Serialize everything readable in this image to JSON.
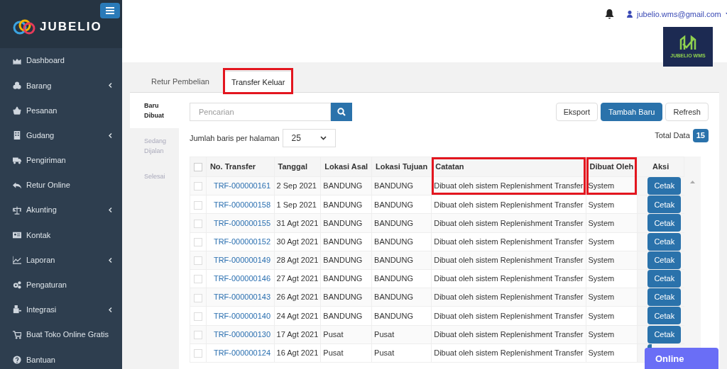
{
  "sidebar": {
    "brand": "JUBELIO",
    "items": [
      {
        "label": "Dashboard",
        "expandable": false
      },
      {
        "label": "Barang",
        "expandable": true
      },
      {
        "label": "Pesanan",
        "expandable": false
      },
      {
        "label": "Gudang",
        "expandable": true
      },
      {
        "label": "Pengiriman",
        "expandable": false
      },
      {
        "label": "Retur Online",
        "expandable": false
      },
      {
        "label": "Akunting",
        "expandable": true
      },
      {
        "label": "Kontak",
        "expandable": false
      },
      {
        "label": "Laporan",
        "expandable": true
      },
      {
        "label": "Pengaturan",
        "expandable": false
      },
      {
        "label": "Integrasi",
        "expandable": true
      },
      {
        "label": "Buat Toko Online Gratis",
        "expandable": false
      },
      {
        "label": "Bantuan",
        "expandable": false
      }
    ]
  },
  "header": {
    "user_email": "jubelio.wms@gmail.com",
    "badge_logo_text": "JUBELIO WMS"
  },
  "tabs": [
    {
      "label": "Retur Pembelian",
      "selected": false,
      "highlighted": false
    },
    {
      "label": "Transfer Keluar",
      "selected": true,
      "highlighted": true
    }
  ],
  "status_nav": [
    {
      "label": "Baru Dibuat",
      "selected": true
    },
    {
      "label": "Sedang Dijalan",
      "selected": false
    },
    {
      "label": "Selesai",
      "selected": false
    }
  ],
  "search": {
    "placeholder": "Pencarian"
  },
  "buttons": [
    {
      "label": "Eksport",
      "kind": "default"
    },
    {
      "label": "Tambah Baru",
      "kind": "primary"
    },
    {
      "label": "Refresh",
      "kind": "default"
    }
  ],
  "page_size": {
    "label": "Jumlah baris per halaman",
    "value": "25"
  },
  "total": {
    "label": "Total Data",
    "value": "15"
  },
  "table": {
    "all_checked": false,
    "columns": [
      {
        "label": "No. Transfer",
        "highlighted": false
      },
      {
        "label": "Tanggal",
        "highlighted": false
      },
      {
        "label": "Lokasi Asal",
        "highlighted": false
      },
      {
        "label": "Lokasi Tujuan",
        "highlighted": false
      },
      {
        "label": "Catatan",
        "highlighted": true
      },
      {
        "label": "Dibuat Oleh",
        "highlighted": true
      },
      {
        "label": "Aksi",
        "highlighted": false
      }
    ],
    "rows": [
      {
        "checked": false,
        "cells": [
          "TRF-000000161",
          "2 Sep 2021",
          "BANDUNG",
          "BANDUNG",
          "Dibuat oleh sistem Replenishment Transfer",
          "System"
        ],
        "action": "Cetak"
      },
      {
        "checked": false,
        "cells": [
          "TRF-000000158",
          "1 Sep 2021",
          "BANDUNG",
          "BANDUNG",
          "Dibuat oleh sistem Replenishment Transfer",
          "System"
        ],
        "action": "Cetak"
      },
      {
        "checked": false,
        "cells": [
          "TRF-000000155",
          "31 Agt 2021",
          "BANDUNG",
          "BANDUNG",
          "Dibuat oleh sistem Replenishment Transfer",
          "System"
        ],
        "action": "Cetak"
      },
      {
        "checked": false,
        "cells": [
          "TRF-000000152",
          "30 Agt 2021",
          "BANDUNG",
          "BANDUNG",
          "Dibuat oleh sistem Replenishment Transfer",
          "System"
        ],
        "action": "Cetak"
      },
      {
        "checked": false,
        "cells": [
          "TRF-000000149",
          "28 Agt 2021",
          "BANDUNG",
          "BANDUNG",
          "Dibuat oleh sistem Replenishment Transfer",
          "System"
        ],
        "action": "Cetak"
      },
      {
        "checked": false,
        "cells": [
          "TRF-000000146",
          "27 Agt 2021",
          "BANDUNG",
          "BANDUNG",
          "Dibuat oleh sistem Replenishment Transfer",
          "System"
        ],
        "action": "Cetak"
      },
      {
        "checked": false,
        "cells": [
          "TRF-000000143",
          "26 Agt 2021",
          "BANDUNG",
          "BANDUNG",
          "Dibuat oleh sistem Replenishment Transfer",
          "System"
        ],
        "action": "Cetak"
      },
      {
        "checked": false,
        "cells": [
          "TRF-000000140",
          "24 Agt 2021",
          "BANDUNG",
          "BANDUNG",
          "Dibuat oleh sistem Replenishment Transfer",
          "System"
        ],
        "action": "Cetak"
      },
      {
        "checked": false,
        "cells": [
          "TRF-000000130",
          "17 Agt 2021",
          "Pusat",
          "Pusat",
          "Dibuat oleh sistem Replenishment Transfer",
          "System"
        ],
        "action": "Cetak"
      },
      {
        "checked": false,
        "cells": [
          "TRF-000000124",
          "16 Agt 2021",
          "Pusat",
          "Pusat",
          "Dibuat oleh sistem Replenishment Transfer",
          "System"
        ]
      }
    ]
  },
  "chat_badge": {
    "label": "Online"
  }
}
